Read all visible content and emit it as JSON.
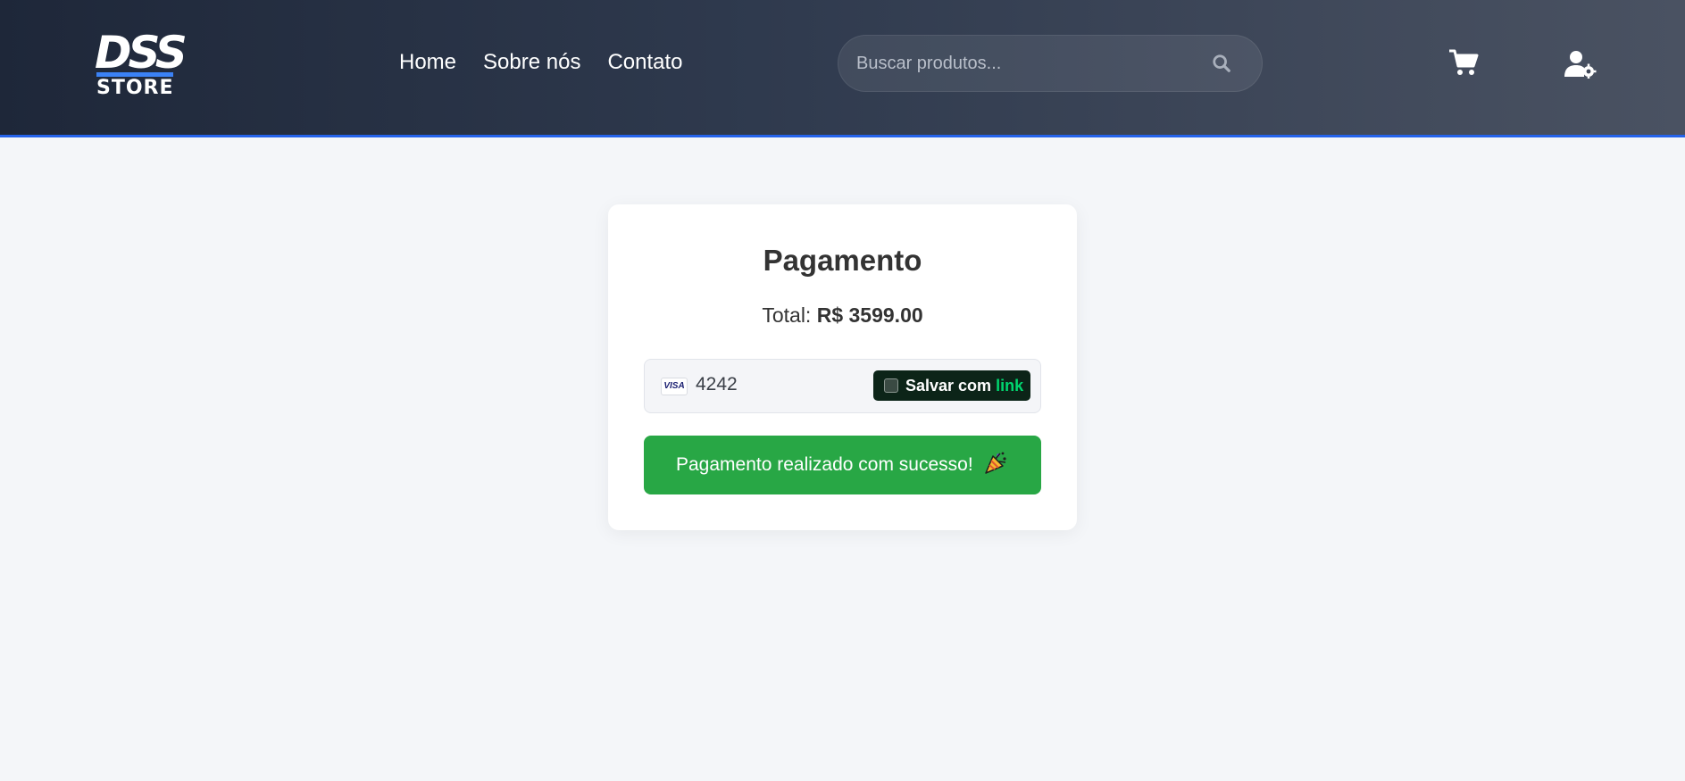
{
  "header": {
    "logo": {
      "top": "DSS",
      "bottom": "STORE"
    },
    "nav": [
      "Home",
      "Sobre nós",
      "Contato"
    ],
    "search": {
      "placeholder": "Buscar produtos...",
      "value": "",
      "icon": "search-icon"
    },
    "cart_icon": "cart-icon",
    "user_icon": "user-settings-icon"
  },
  "payment": {
    "title": "Pagamento",
    "total_label": "Total:",
    "total_value": "R$ 3599.00",
    "card": {
      "brand": "VISA",
      "last4": "4242",
      "save_label": "Salvar com",
      "save_brand": "link"
    },
    "success_message": "Pagamento realizado com sucesso!",
    "success_icon": "party-popper-icon"
  },
  "colors": {
    "accent": "#2563eb",
    "success": "#28a745",
    "link_brand": "#00d66f"
  }
}
